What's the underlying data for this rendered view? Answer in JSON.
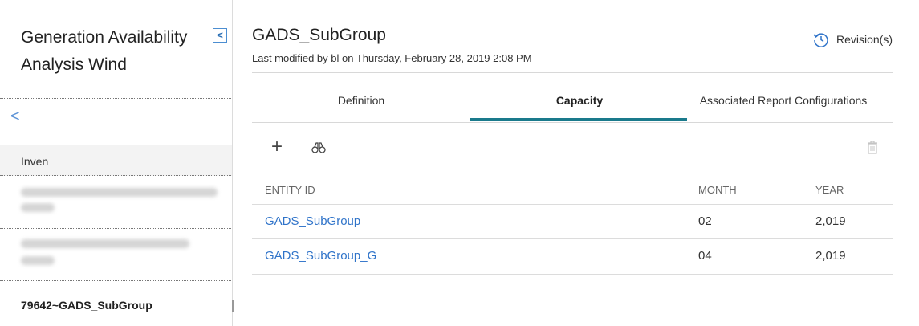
{
  "sidebar": {
    "title": "Generation Availability Analysis Wind",
    "collapse_label": "<",
    "back_label": "<",
    "column_header": "Inven",
    "current_item": "79642~GADS_SubGroup"
  },
  "record": {
    "title": "GADS_SubGroup",
    "subtitle": "Last modified by bl on Thursday, February 28, 2019 2:08 PM",
    "revisions_label": "Revision(s)"
  },
  "tabs": [
    {
      "label": "Definition"
    },
    {
      "label": "Capacity",
      "active": true
    },
    {
      "label": "Associated Report Configurations"
    }
  ],
  "toolbar": {
    "add_icon": "plus-icon",
    "search_icon": "binoculars-icon",
    "delete_icon": "trash-icon"
  },
  "table": {
    "columns": [
      "ENTITY ID",
      "MONTH",
      "YEAR"
    ],
    "rows": [
      {
        "entity_id": "GADS_SubGroup",
        "month": "02",
        "year": "2,019"
      },
      {
        "entity_id": "GADS_SubGroup_G",
        "month": "04",
        "year": "2,019"
      }
    ]
  },
  "colors": {
    "accent": "#1a7a8c",
    "link": "#2f73c9"
  }
}
